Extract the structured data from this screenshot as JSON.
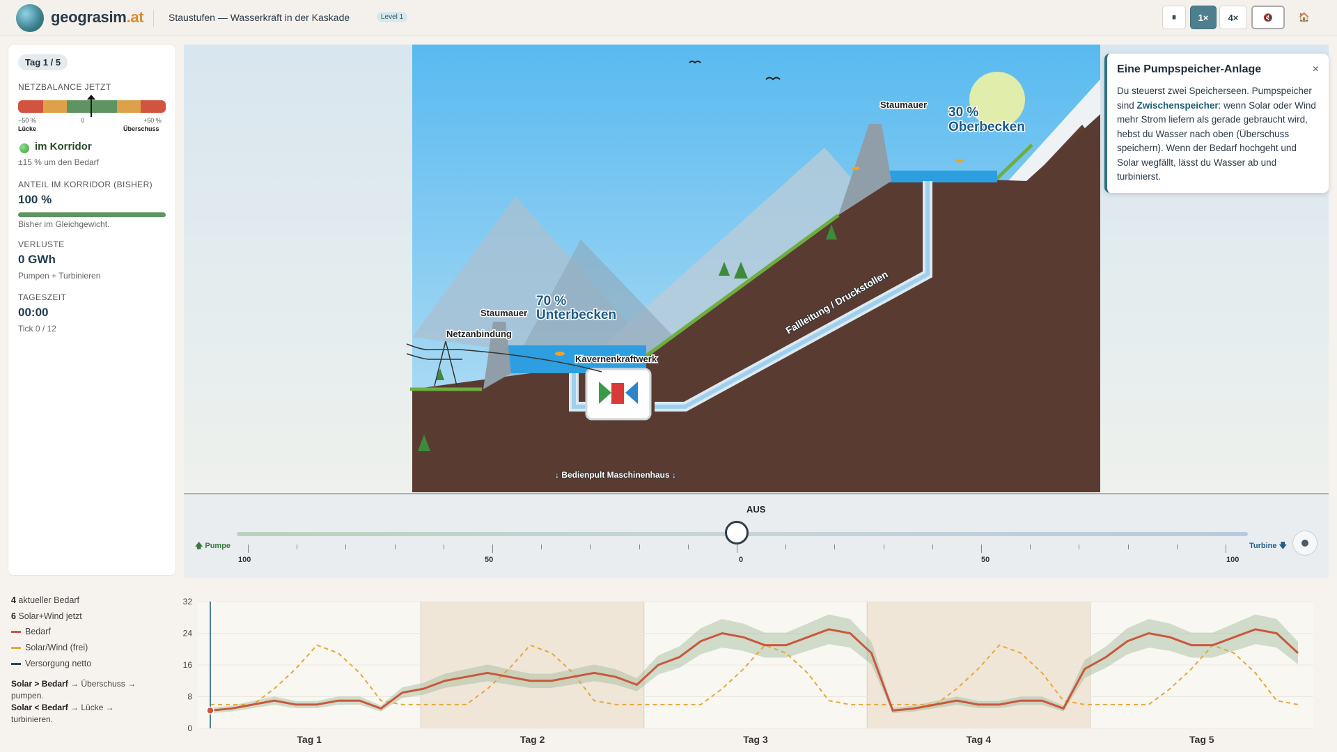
{
  "header": {
    "brand_main": "geograsim",
    "brand_tld": ".at",
    "title": "Staustufen — Wasserkraft in der Kaskade",
    "level": "Level 1",
    "btn_pause": "⏸",
    "btn_speed1": "1×",
    "btn_speed4": "4×",
    "btn_sound": "🔇",
    "btn_home": "🏠"
  },
  "panel": {
    "day_chip": "Tag 1 / 5",
    "balance_label": "NETZBALANCE JETZT",
    "scale_left": "−50 %",
    "scale_mid": "0",
    "scale_right": "+50 %",
    "gap_label": "Lücke",
    "surplus_label": "Überschuss",
    "status": "im Korridor",
    "status_sub": "±15 % um den Bedarf",
    "share_label": "ANTEIL IM KORRIDOR (BISHER)",
    "share_value": "100 %",
    "share_fill": 1.0,
    "share_sub": "Bisher im Gleichgewicht.",
    "loss_label": "VERLUSTE",
    "loss_value": "0 GWh",
    "loss_sub": "Pumpen + Turbinieren",
    "time_label": "TAGESZEIT",
    "time_value": "00:00",
    "time_sub": "Tick 0 / 12",
    "balance_value": 0
  },
  "scene": {
    "dam_upper": "Staumauer",
    "upper_pct": "30 %",
    "upper_name": "Oberbecken",
    "dam_lower": "Staumauer",
    "lower_pct": "70 %",
    "lower_name": "Unterbecken",
    "grid": "Netzanbindung",
    "plant": "Kavernenkraftwerk",
    "penstock": "Fallleitung / Druckstollen",
    "console": "↓ Bedienpult Maschinenhaus ↓"
  },
  "info": {
    "title": "Eine Pumpspeicher-Anlage",
    "close": "×",
    "text_1": "Du steuerst zwei Speicherseen. Pumpspeicher sind ",
    "text_bold": "Zwischenspeicher",
    "text_2": ": wenn Solar oder Wind mehr Strom liefern als gerade gebraucht wird, hebst du Wasser nach oben (Überschuss speichern). Wenn der Bedarf hochgeht und Solar wegfällt, lässt du Wasser ab und turbinierst."
  },
  "control": {
    "state": "AUS",
    "pump_label": "🡅 Pumpe",
    "turbine_label": "Turbine 🡇",
    "ticks": [
      "100",
      "50",
      "0",
      "50",
      "100"
    ],
    "slider_value": 0
  },
  "legend": {
    "demand_now_num": "4",
    "demand_now_text": " aktueller Bedarf",
    "solar_now_num": "6",
    "solar_now_text": " Solar+Wind jetzt",
    "series_demand": "Bedarf",
    "series_solar": "Solar/Wind (frei)",
    "series_net": "Versorgung netto",
    "hint1_bold": "Solar > Bedarf",
    "hint1_text": " → Überschuss → pumpen.",
    "hint2_bold": "Solar < Bedarf",
    "hint2_text": " → Lücke → turbinieren."
  },
  "colors": {
    "demand": "#c9573e",
    "solar": "#e6a73a",
    "net": "#1f4e5f",
    "band": "#9fb89a",
    "accent": "#4d7f8f"
  },
  "chart_data": {
    "type": "line",
    "ylim": [
      0,
      32
    ],
    "yticks": [
      "0",
      "8",
      "16",
      "24",
      "32"
    ],
    "x_categories": [
      "Tag 1",
      "Tag 2",
      "Tag 3",
      "Tag 4",
      "Tag 5"
    ],
    "series": [
      {
        "name": "Bedarf",
        "values": [
          4.5,
          5,
          6,
          7,
          6,
          6,
          7,
          7,
          5,
          9,
          10,
          12,
          13,
          14,
          13,
          12,
          12,
          13,
          14,
          13,
          11,
          16,
          18,
          22,
          24,
          23,
          21,
          21,
          23,
          25,
          24,
          19,
          4.5,
          5,
          6,
          7,
          6,
          6,
          7,
          7,
          5,
          15,
          18,
          22,
          24,
          23,
          21,
          21,
          23,
          25,
          24,
          19
        ]
      },
      {
        "name": "Solar/Wind (frei)",
        "values": [
          6,
          6,
          6,
          10,
          15,
          21,
          19,
          14,
          7,
          6,
          6,
          6,
          6,
          10,
          15,
          21,
          19,
          14,
          7,
          6,
          6,
          6,
          6,
          6,
          10,
          15,
          21,
          19,
          14,
          7,
          6,
          6,
          6,
          6,
          6,
          10,
          15,
          21,
          19,
          14,
          7,
          6,
          6,
          6,
          6,
          10,
          15,
          21,
          19,
          14,
          7,
          6
        ]
      }
    ],
    "night_shading_days": [
      2,
      4
    ],
    "current_tick": 0,
    "current_value": 4.5
  }
}
